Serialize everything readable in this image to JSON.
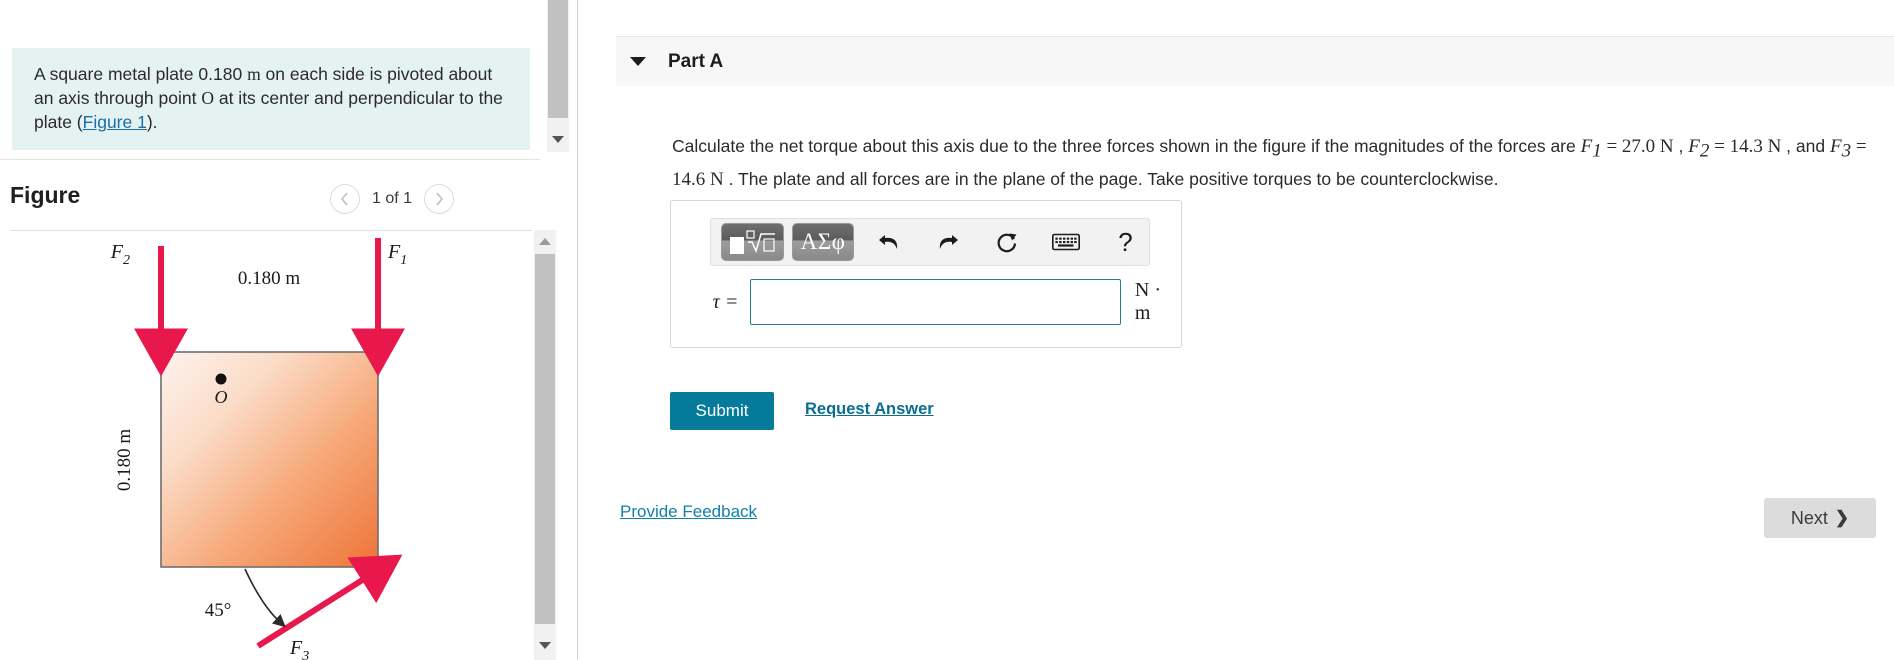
{
  "problem": {
    "statement_part1": "A square metal plate 0.180 ",
    "statement_unit": "m",
    "statement_part2": " on each side is pivoted about an axis through point ",
    "statement_point": "O",
    "statement_part3": " at its center and perpendicular to the plate (",
    "statement_link": "Figure 1",
    "statement_part4": ")."
  },
  "figure": {
    "title": "Figure",
    "prev_icon": "chevron-left-icon",
    "next_icon": "chevron-right-icon",
    "counter": "1 of 1",
    "labels": {
      "f1": "F",
      "f1_sub": "1",
      "f2": "F",
      "f2_sub": "2",
      "f3": "F",
      "f3_sub": "3",
      "top_dim": "0.180 m",
      "left_dim": "0.180 m",
      "angle": "45°",
      "center_point": "O"
    },
    "colors": {
      "arrow": "#e8174c",
      "plate_light": "#fdf2ec",
      "plate_dark": "#f07a3f",
      "plate_border": "#6e6e6e"
    }
  },
  "part": {
    "caret_icon": "caret-down-icon",
    "title": "Part A",
    "question_a": "Calculate the net torque about this axis due to the three forces shown in the figure if the magnitudes of the forces are ",
    "q_f1": "F",
    "q_f1_sub": "1",
    "q_f1_val": " = 27.0 N",
    "q_sep1": " , ",
    "q_f2": "F",
    "q_f2_sub": "2",
    "q_f2_val": " = 14.3 N",
    "q_sep2": " , and ",
    "q_f3": "F",
    "q_f3_sub": "3",
    "q_f3_val": " = 14.6 N",
    "question_b": " . The plate and all forces are in the plane of the page. Take positive torques to be counterclockwise."
  },
  "answer": {
    "toolbar": {
      "template_icon": "math-template-icon",
      "greek_label": "ΑΣφ",
      "undo_icon": "undo-arrow-icon",
      "redo_icon": "redo-arrow-icon",
      "reset_icon": "reset-circular-arrow-icon",
      "keyboard_icon": "keyboard-icon",
      "help_icon": "question-mark-icon"
    },
    "variable_label": "τ =",
    "input_value": "",
    "input_placeholder": "",
    "unit": "N · m",
    "submit_label": "Submit",
    "request_label": "Request Answer"
  },
  "footer": {
    "feedback_label": "Provide Feedback",
    "next_label": "Next",
    "next_icon": "chevron-right-icon"
  },
  "colors": {
    "accent_teal": "#067a9b",
    "link_blue": "#1380a8",
    "statement_bg": "#e4f3f1",
    "input_border": "#2b7a93"
  }
}
